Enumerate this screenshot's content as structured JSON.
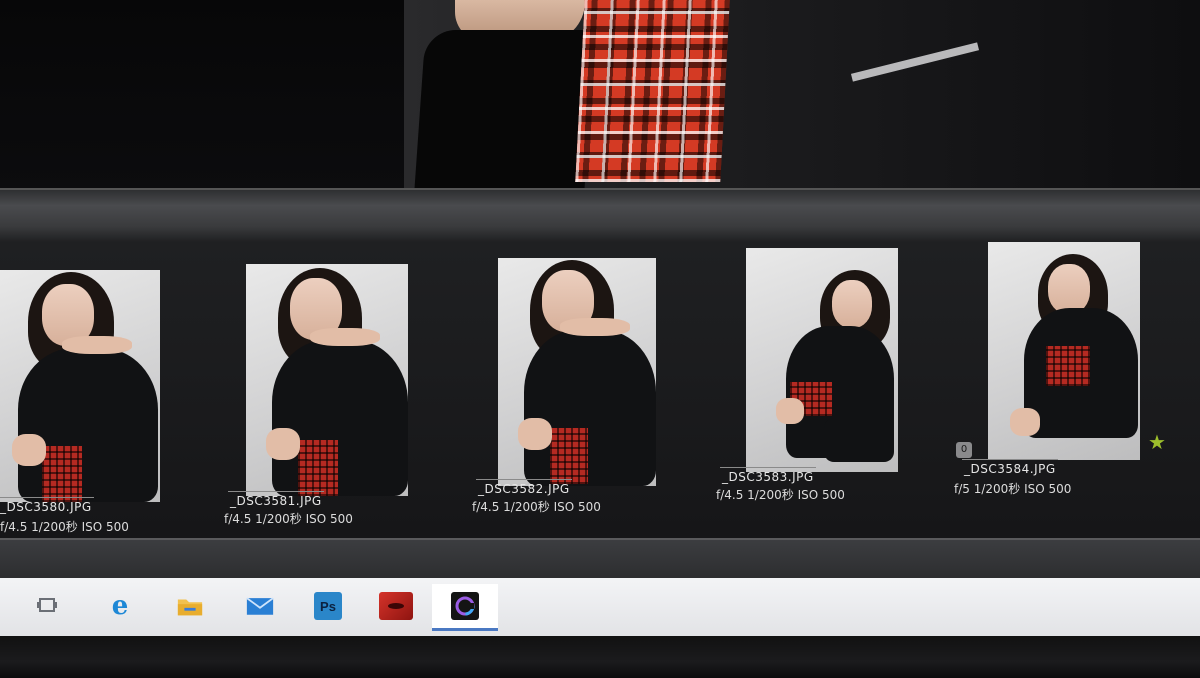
{
  "filmstrip": {
    "items": [
      {
        "filename": "_DSC3580.JPG",
        "meta": "f/4.5  1/200秒  ISO 500",
        "pose": "lean"
      },
      {
        "filename": "_DSC3581.JPG",
        "meta": "f/4.5  1/200秒  ISO 500",
        "pose": "lean"
      },
      {
        "filename": "_DSC3582.JPG",
        "meta": "f/4.5  1/200秒  ISO 500",
        "pose": "lean"
      },
      {
        "filename": "_DSC3583.JPG",
        "meta": "f/4.5  1/200秒  ISO 500",
        "pose": "sit"
      },
      {
        "filename": "_DSC3584.JPG",
        "meta": "f/5  1/200秒  ISO 500",
        "pose": "sit",
        "rating_star": true,
        "badge": "0"
      }
    ]
  },
  "taskbar": {
    "apps": [
      {
        "name": "task-view",
        "icon": "task-view-icon"
      },
      {
        "name": "edge",
        "icon": "edge-icon",
        "glyph": "e"
      },
      {
        "name": "file-explorer",
        "icon": "folder-icon"
      },
      {
        "name": "mail",
        "icon": "mail-icon"
      },
      {
        "name": "photoshop",
        "icon": "photoshop-icon",
        "glyph": "Ps"
      },
      {
        "name": "red-app",
        "icon": "red-app-icon"
      },
      {
        "name": "capture-one",
        "icon": "capture-one-icon",
        "active": true
      }
    ]
  },
  "colors": {
    "star": "#9dbf2c",
    "taskbar_active": "#4a78c2",
    "edge": "#1e88d6",
    "folder": "#f2c14e",
    "mail": "#2a7fd4",
    "photoshop": "#2a86c9",
    "red_app": "#c2291f"
  }
}
